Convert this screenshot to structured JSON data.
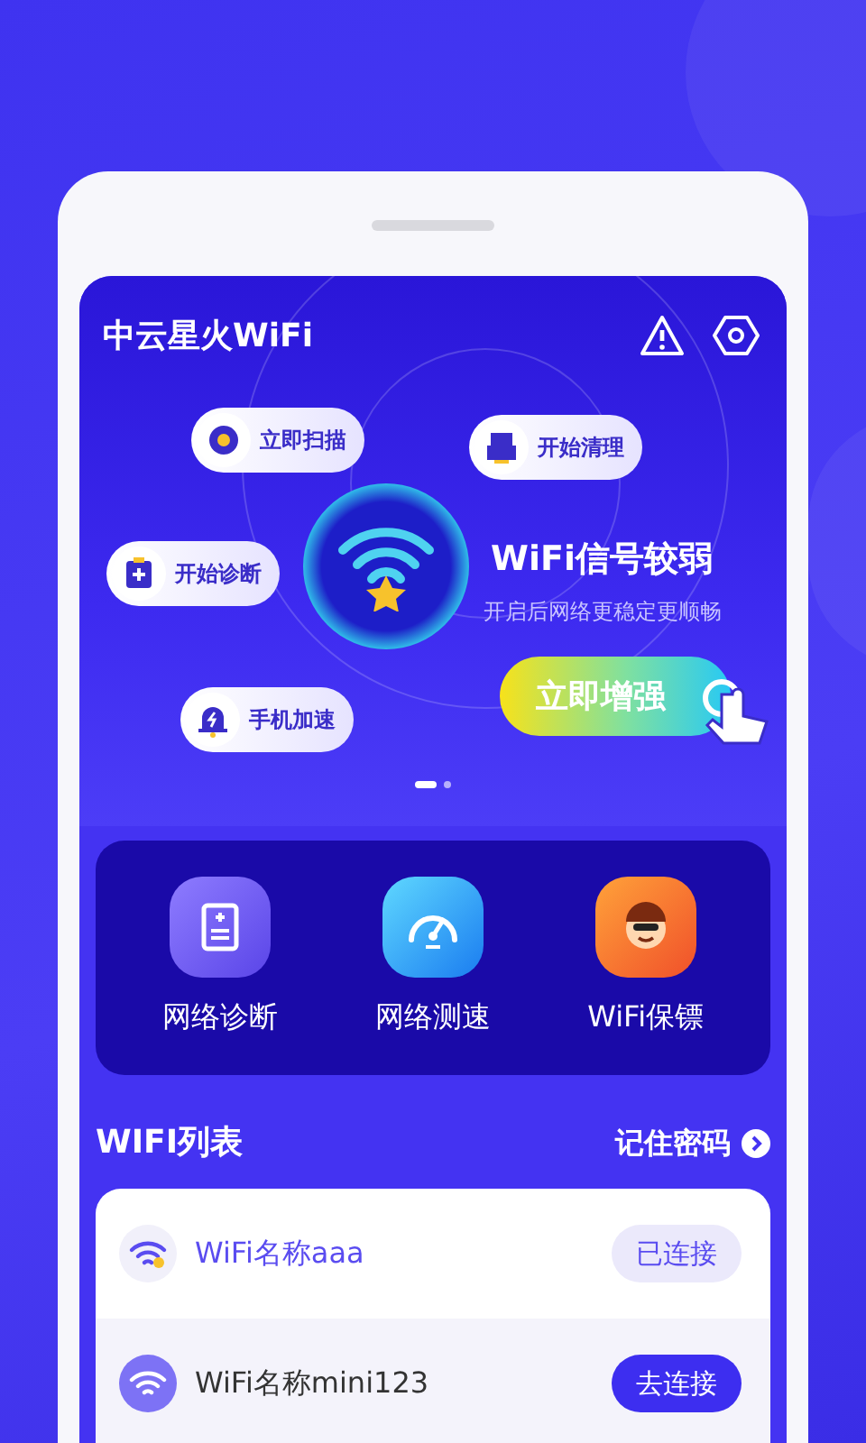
{
  "app_title": "中云星火WiFi",
  "quick_actions": [
    {
      "kind": "scan",
      "label": "立即扫描"
    },
    {
      "kind": "clean",
      "label": "开始清理"
    },
    {
      "kind": "diagnose",
      "label": "开始诊断"
    },
    {
      "kind": "boost",
      "label": "手机加速"
    }
  ],
  "signal_status": {
    "title": "WiFi信号较弱",
    "subtitle": "开启后网络更稳定更顺畅",
    "button": "立即增强"
  },
  "pager": [
    {
      "selected": true
    },
    {
      "selected": false
    }
  ],
  "tools": [
    {
      "kind": "diagnose",
      "label": "网络诊断"
    },
    {
      "kind": "speed",
      "label": "网络测速"
    },
    {
      "kind": "guard",
      "label": "WiFi保镖"
    }
  ],
  "wifi_list": {
    "title": "WIFI列表",
    "link": "记住密码",
    "networks": [
      {
        "name": "WiFi名称aaa",
        "action": "已连接",
        "connected": true
      },
      {
        "name": "WiFi名称mini123",
        "action": "去连接",
        "connected": false
      }
    ]
  }
}
